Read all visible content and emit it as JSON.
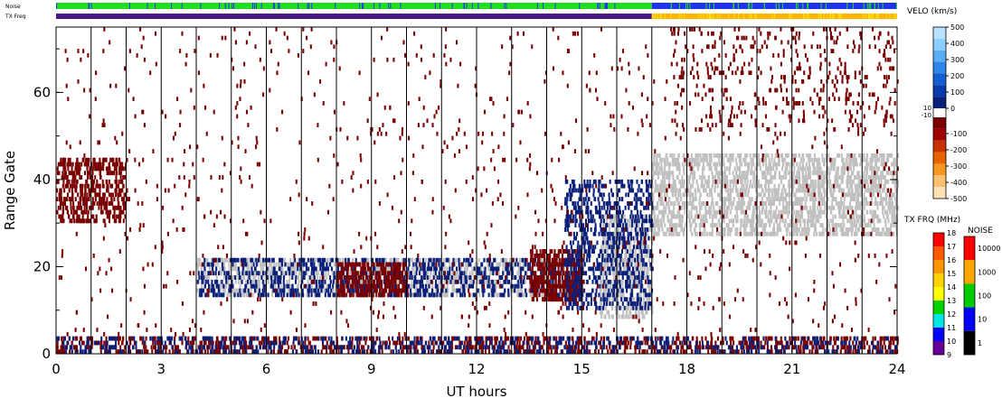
{
  "strips": {
    "noise_label": "Noise",
    "txfreq_label": "TX Freq"
  },
  "chart_data": {
    "type": "heatmap",
    "xlabel": "UT hours",
    "ylabel": "Range Gate",
    "xlim": [
      0,
      24
    ],
    "ylim": [
      0,
      75
    ],
    "x_ticks": [
      "0",
      "3",
      "6",
      "9",
      "12",
      "15",
      "18",
      "21",
      "24"
    ],
    "y_ticks": [
      "0",
      "20",
      "40",
      "60"
    ],
    "scan_boundaries_ut": [
      1.0,
      2.0,
      3.0,
      4.0,
      5.0,
      6.0,
      7.0,
      8.0,
      9.0,
      10.0,
      11.0,
      12.0,
      13.0,
      14.0,
      15.0,
      16.0,
      17.0,
      18.0,
      19.0,
      20.0,
      21.0,
      22.0,
      23.0
    ],
    "noise_strip": {
      "low_until_ut": 17.0,
      "low_color": "#22dd22",
      "high_color": "#2233ee"
    },
    "txfreq_strip": {
      "change_ut": 17.0,
      "before_color": "#4b1a86",
      "after_color": "#ffb400"
    },
    "regions": [
      {
        "name": "ground-scatter-main",
        "x": [
          17.0,
          24.0
        ],
        "y": [
          27,
          46
        ],
        "color": "#c0c0c0",
        "density": 0.85
      },
      {
        "name": "ground-scatter-ramp",
        "x": [
          15.5,
          17.0
        ],
        "y": [
          8,
          32
        ],
        "color": "#c0c0c0",
        "density": 0.6
      },
      {
        "name": "band-gray",
        "x": [
          4.0,
          15.0
        ],
        "y": [
          13,
          22
        ],
        "color": "#c0c0c0",
        "density": 0.45
      },
      {
        "name": "band-navy",
        "x": [
          4.0,
          15.0
        ],
        "y": [
          13,
          22
        ],
        "color": "#0a1f7a",
        "density": 0.35
      },
      {
        "name": "band-maroon",
        "x": [
          8.0,
          10.0
        ],
        "y": [
          13,
          21
        ],
        "color": "#7a0000",
        "density": 0.8
      },
      {
        "name": "band-maroon-2",
        "x": [
          13.5,
          15.0
        ],
        "y": [
          12,
          24
        ],
        "color": "#7a0000",
        "density": 0.85
      },
      {
        "name": "early-maroon",
        "x": [
          0.0,
          2.0
        ],
        "y": [
          30,
          45
        ],
        "color": "#7a0000",
        "density": 0.6
      },
      {
        "name": "near-range-maroon",
        "x": [
          0.0,
          24.0
        ],
        "y": [
          0,
          4
        ],
        "color": "#7a0000",
        "density": 0.4
      },
      {
        "name": "near-range-navy",
        "x": [
          0.0,
          24.0
        ],
        "y": [
          0,
          4
        ],
        "color": "#0a1f7a",
        "density": 0.25
      },
      {
        "name": "late-top-maroon",
        "x": [
          17.5,
          24.0
        ],
        "y": [
          50,
          75
        ],
        "color": "#7a0000",
        "density": 0.08
      },
      {
        "name": "diagonal-navy",
        "x": [
          14.5,
          17.0
        ],
        "y": [
          10,
          40
        ],
        "color": "#0a1f7a",
        "density": 0.4
      },
      {
        "name": "scattered-noise",
        "x": [
          0.0,
          24.0
        ],
        "y": [
          0,
          75
        ],
        "color": "#7a0000",
        "density": 0.02
      }
    ]
  },
  "velocity_scale": {
    "title": "VELO (km/s)",
    "ticks": [
      "500",
      "400",
      "300",
      "200",
      "100",
      "0",
      "-100",
      "-200",
      "-300",
      "-400",
      "-500"
    ],
    "gap_labels": [
      "10",
      "-10"
    ],
    "colors": [
      "#b7e3ff",
      "#8ccfff",
      "#5aaef5",
      "#2d86e8",
      "#1560d0",
      "#0b3aa8",
      "#0a1f7a",
      "#7a0000",
      "#a00000",
      "#c83200",
      "#e66400",
      "#f5961e",
      "#fcc070",
      "#ffe0b0"
    ]
  },
  "txfreq_scale": {
    "title": "TX FRQ (MHz)",
    "ticks": [
      "18",
      "17",
      "16",
      "15",
      "14",
      "13",
      "12",
      "11",
      "10",
      "9"
    ],
    "colors": [
      "#ff0000",
      "#ff5a00",
      "#ff9600",
      "#ffd200",
      "#ffff00",
      "#00d200",
      "#00e6e6",
      "#0000ff",
      "#640096",
      "#000000"
    ]
  },
  "noise_scale": {
    "title": "NOISE",
    "ticks": [
      "10000",
      "1000",
      "100",
      "10",
      "1"
    ],
    "colors": [
      "#ff0000",
      "#ffa500",
      "#00cc00",
      "#0000ff",
      "#000000"
    ]
  }
}
